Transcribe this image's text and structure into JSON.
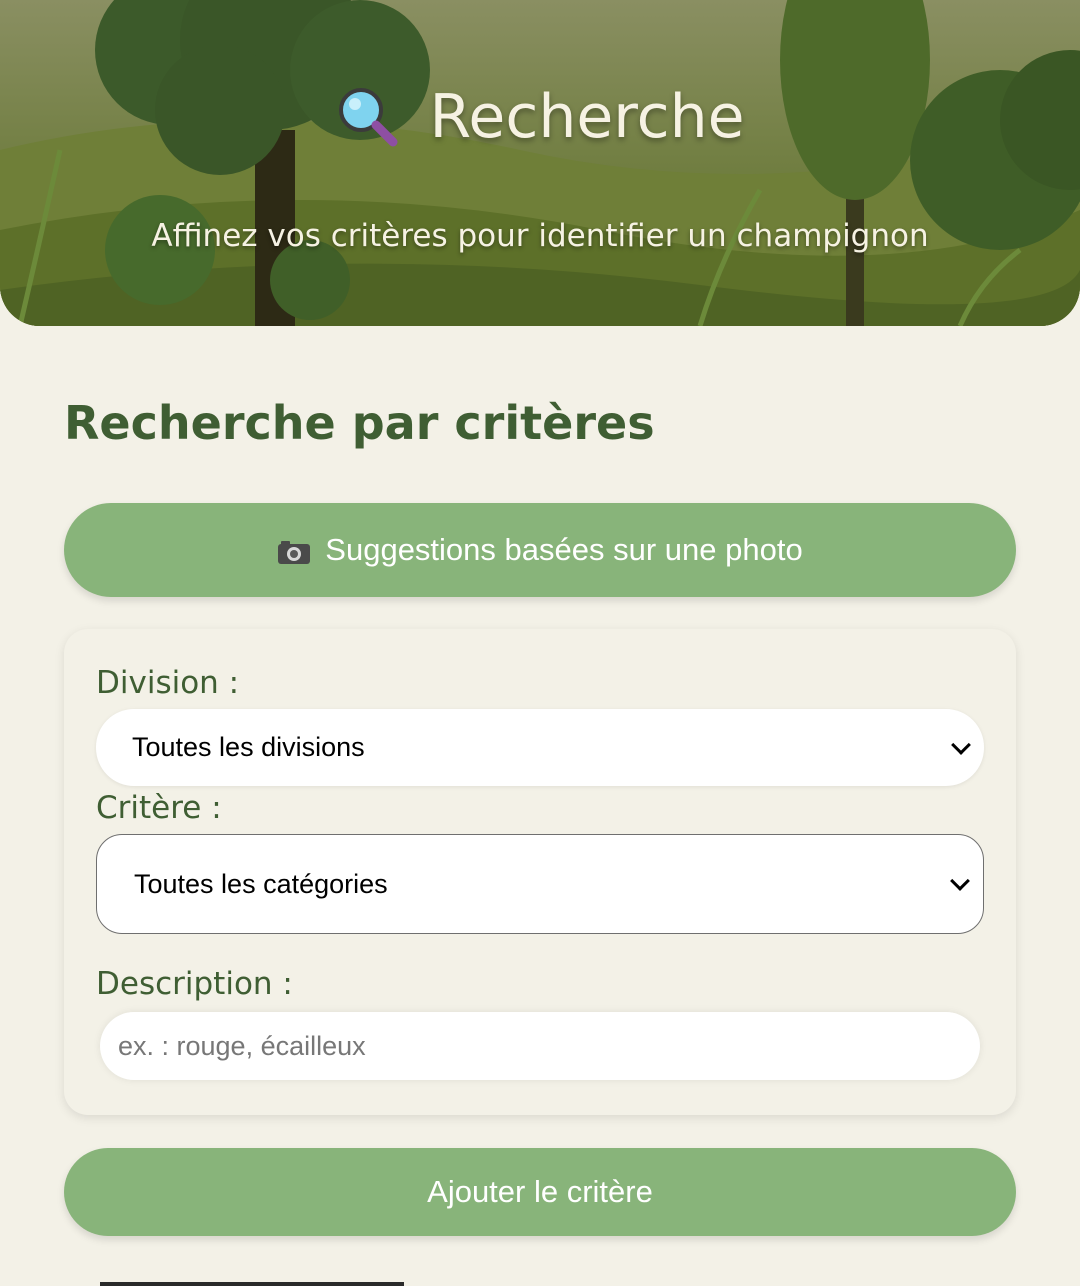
{
  "header": {
    "title": "Recherche",
    "subtitle": "Affinez vos critères pour identifier un champignon",
    "icon": "magnifying-glass-icon"
  },
  "main": {
    "section_title": "Recherche par critères",
    "photo_button_label": "Suggestions basées sur une photo",
    "photo_button_icon": "camera-icon",
    "form": {
      "division_label": "Division :",
      "division_value": "Toutes les divisions",
      "critere_label": "Critère :",
      "critere_value": "Toutes les catégories",
      "description_label": "Description :",
      "description_placeholder": "ex. : rouge, écailleux",
      "description_value": ""
    },
    "add_button_label": "Ajouter le critère"
  },
  "colors": {
    "background": "#f3f1e7",
    "accent_green": "#88b47a",
    "title_green": "#3f5e33"
  }
}
